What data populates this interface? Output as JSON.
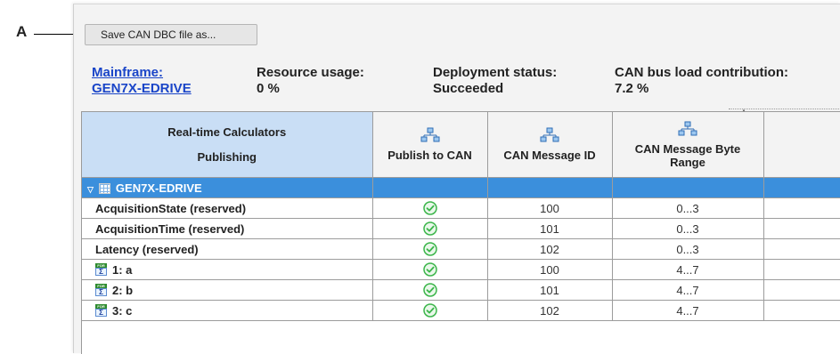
{
  "annotation": {
    "label": "A"
  },
  "toolbar": {
    "save_label": "Save CAN DBC file as..."
  },
  "info": {
    "mainframe": {
      "label": "Mainframe:",
      "value": "GEN7X-EDRIVE"
    },
    "resource_usage": {
      "label": "Resource usage:",
      "value": "0 %"
    },
    "deployment_status": {
      "label": "Deployment status:",
      "value": "Succeeded"
    },
    "can_bus_load": {
      "label": "CAN bus load contribution:",
      "value": "7.2 %"
    }
  },
  "grid": {
    "columns": {
      "calculators": {
        "line1": "Real-time Calculators",
        "line2": "Publishing"
      },
      "publish": {
        "label": "Publish to CAN",
        "icon": "network-icon"
      },
      "message_id": {
        "label": "CAN Message ID",
        "icon": "network-icon"
      },
      "byte_range": {
        "label": "CAN Message Byte Range",
        "icon": "network-icon"
      }
    },
    "group": {
      "name": "GEN7X-EDRIVE",
      "icon": "grid-icon",
      "expanded": true
    },
    "rows": [
      {
        "name": "AcquisitionState (reserved)",
        "publish": true,
        "message_id": "100",
        "byte_range": "0...3",
        "icon": ""
      },
      {
        "name": "AcquisitionTime (reserved)",
        "publish": true,
        "message_id": "101",
        "byte_range": "0...3",
        "icon": ""
      },
      {
        "name": "Latency (reserved)",
        "publish": true,
        "message_id": "102",
        "byte_range": "0...3",
        "icon": ""
      },
      {
        "name": "1: a",
        "publish": true,
        "message_id": "100",
        "byte_range": "4...7",
        "icon": "for-sigma-icon"
      },
      {
        "name": "2: b",
        "publish": true,
        "message_id": "101",
        "byte_range": "4...7",
        "icon": "for-sigma-icon"
      },
      {
        "name": "3: c",
        "publish": true,
        "message_id": "102",
        "byte_range": "4...7",
        "icon": "for-sigma-icon"
      }
    ]
  },
  "colors": {
    "link": "#1a45c8",
    "group_row": "#3b8fdc",
    "selected_header": "#c9def5",
    "check_green": "#3bb54a"
  }
}
